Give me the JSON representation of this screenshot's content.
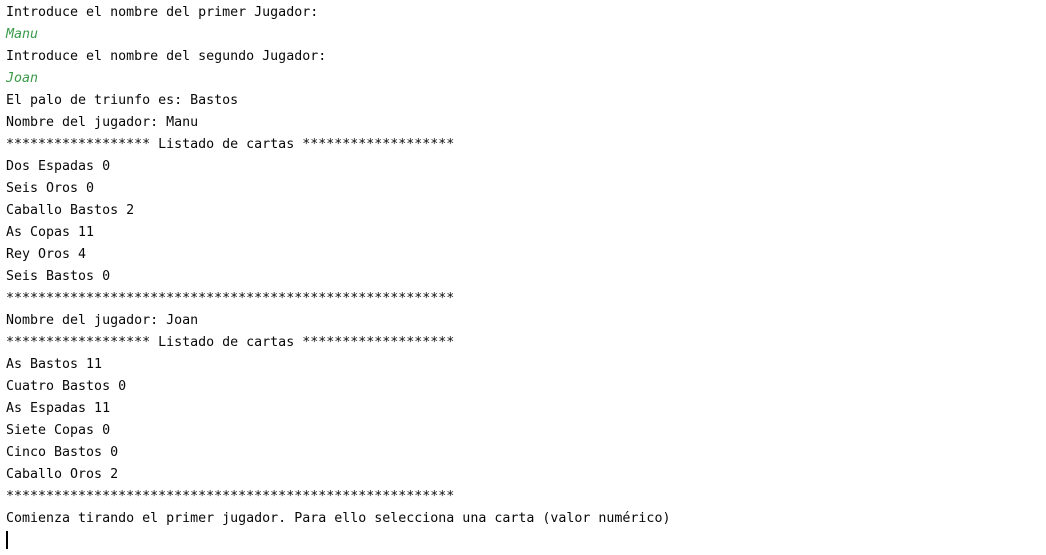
{
  "console": {
    "lines": [
      {
        "text": "Introduce el nombre del primer Jugador:",
        "type": "output"
      },
      {
        "text": "Manu",
        "type": "input"
      },
      {
        "text": "Introduce el nombre del segundo Jugador:",
        "type": "output"
      },
      {
        "text": "Joan",
        "type": "input"
      },
      {
        "text": "El palo de triunfo es: Bastos",
        "type": "output"
      },
      {
        "text": "Nombre del jugador: Manu",
        "type": "output"
      },
      {
        "text": "****************** Listado de cartas *******************",
        "type": "output"
      },
      {
        "text": "Dos Espadas 0",
        "type": "output"
      },
      {
        "text": "Seis Oros 0",
        "type": "output"
      },
      {
        "text": "Caballo Bastos 2",
        "type": "output"
      },
      {
        "text": "As Copas 11",
        "type": "output"
      },
      {
        "text": "Rey Oros 4",
        "type": "output"
      },
      {
        "text": "Seis Bastos 0",
        "type": "output"
      },
      {
        "text": "********************************************************",
        "type": "output"
      },
      {
        "text": "Nombre del jugador: Joan",
        "type": "output"
      },
      {
        "text": "****************** Listado de cartas *******************",
        "type": "output"
      },
      {
        "text": "As Bastos 11",
        "type": "output"
      },
      {
        "text": "Cuatro Bastos 0",
        "type": "output"
      },
      {
        "text": "As Espadas 11",
        "type": "output"
      },
      {
        "text": "Siete Copas 0",
        "type": "output"
      },
      {
        "text": "Cinco Bastos 0",
        "type": "output"
      },
      {
        "text": "Caballo Oros 2",
        "type": "output"
      },
      {
        "text": "********************************************************",
        "type": "output"
      },
      {
        "text": "Comienza tirando el primer jugador. Para ello selecciona una carta (valor numérico)",
        "type": "output"
      }
    ],
    "input_color": "#3a9a4a"
  }
}
